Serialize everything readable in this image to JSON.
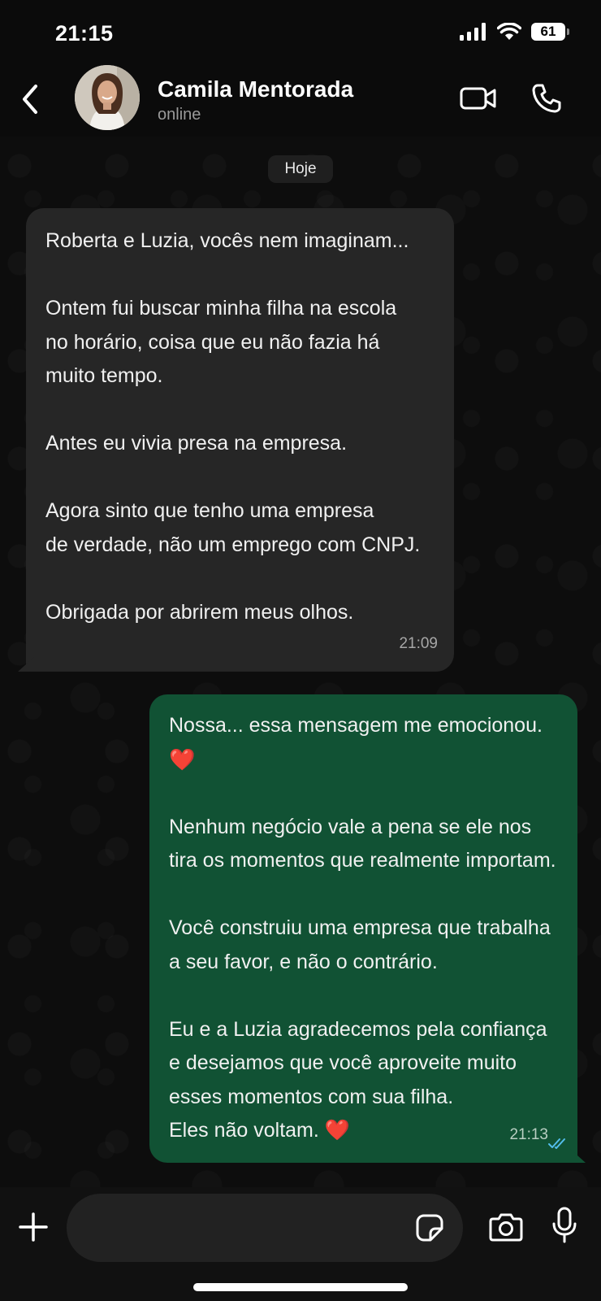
{
  "status_bar": {
    "time": "21:15",
    "battery": "61"
  },
  "header": {
    "name": "Camila Mentorada",
    "status": "online"
  },
  "date_separator": "Hoje",
  "messages": [
    {
      "direction": "incoming",
      "lines": [
        "Roberta e Luzia, vocês nem imaginam...",
        "",
        "Ontem fui buscar minha filha na escola",
        "no horário, coisa que eu não fazia há",
        "muito tempo.",
        "",
        "Antes eu vivia presa na empresa.",
        "",
        "Agora sinto que tenho uma empresa",
        "de verdade, não um emprego com CNPJ.",
        "",
        "Obrigada por abrirem meus olhos."
      ],
      "time": "21:09"
    },
    {
      "direction": "outgoing",
      "lines": [
        "Nossa... essa mensagem me emocionou.",
        "❤️",
        "",
        "Nenhum negócio vale a pena se ele nos",
        "tira os momentos que realmente importam.",
        "",
        "Você construiu uma empresa que trabalha",
        "a seu favor, e não o contrário.",
        "",
        "Eu e a Luzia agradecemos pela confiança",
        "e desejamos que você aproveite muito",
        "esses momentos com sua filha.",
        "Eles não voltam. ❤️"
      ],
      "time": "21:13",
      "read": true
    }
  ],
  "composer": {
    "value": "",
    "placeholder": ""
  },
  "colors": {
    "incoming_bubble": "#262626",
    "outgoing_bubble": "#115234",
    "read_ticks": "#53bdeb",
    "heart": "#e1262f"
  },
  "icons": [
    "back-icon",
    "video-call-icon",
    "phone-icon",
    "plus-icon",
    "sticker-icon",
    "camera-icon",
    "mic-icon",
    "signal-icon",
    "wifi-icon",
    "battery-icon"
  ]
}
